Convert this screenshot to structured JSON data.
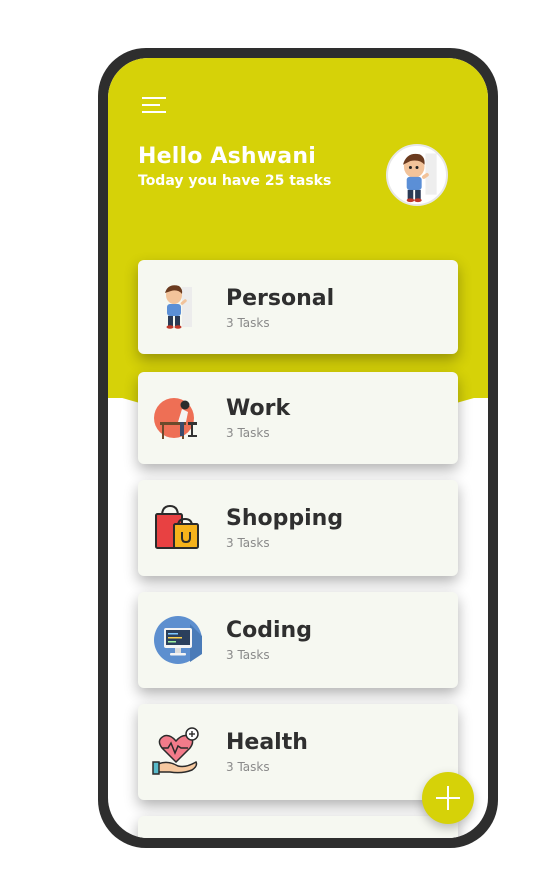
{
  "header": {
    "title": "Hello Ashwani",
    "subtitle": "Today you have 25 tasks"
  },
  "colors": {
    "accent": "#d6d208",
    "card_background": "#f6f8f1",
    "phone_frame": "#2e2e2e"
  },
  "categories": [
    {
      "label": "Personal",
      "count": "3 Tasks",
      "icon": "person-waving-icon"
    },
    {
      "label": "Work",
      "count": "3 Tasks",
      "icon": "person-at-desk-icon"
    },
    {
      "label": "Shopping",
      "count": "3 Tasks",
      "icon": "shopping-bags-icon"
    },
    {
      "label": "Coding",
      "count": "3 Tasks",
      "icon": "computer-monitor-icon"
    },
    {
      "label": "Health",
      "count": "3 Tasks",
      "icon": "heart-in-hand-icon"
    }
  ],
  "fab": {
    "icon": "plus-icon"
  }
}
